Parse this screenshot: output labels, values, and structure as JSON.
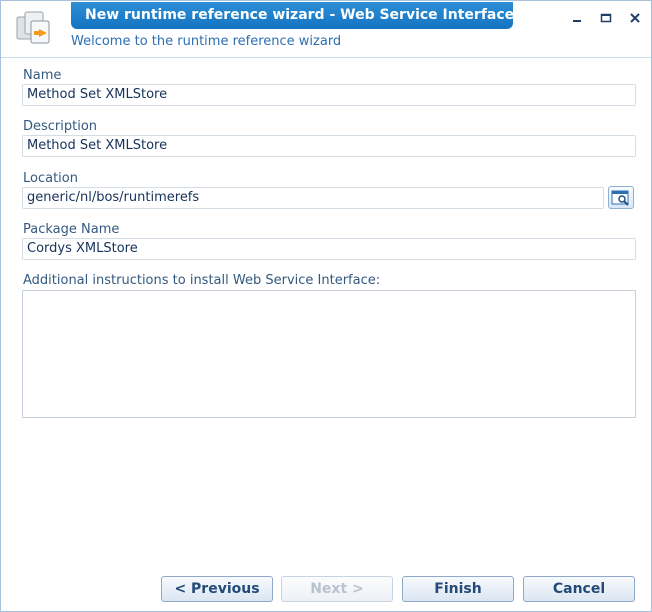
{
  "window": {
    "title": "New runtime reference wizard - Web Service Interface",
    "subtitle": "Welcome to the runtime reference wizard",
    "controls": {
      "minimize_icon": "minimize-icon",
      "maximize_icon": "maximize-icon",
      "close_icon": "close-icon"
    },
    "app_icon": "wizard-app-icon"
  },
  "form": {
    "name": {
      "label": "Name",
      "value": "Method Set XMLStore"
    },
    "description": {
      "label": "Description",
      "value": "Method Set XMLStore"
    },
    "location": {
      "label": "Location",
      "value": "generic/nl/bos/runtimerefs",
      "browse_icon": "browse-search-icon"
    },
    "package_name": {
      "label": "Package Name",
      "value": "Cordys XMLStore"
    },
    "instructions": {
      "label": "Additional instructions to install Web Service Interface:",
      "value": ""
    }
  },
  "buttons": {
    "previous": "< Previous",
    "next": "Next >",
    "finish": "Finish",
    "cancel": "Cancel"
  },
  "colors": {
    "accent": "#1a7bc9",
    "title_text": "#ffffff",
    "label_text": "#34597f"
  }
}
